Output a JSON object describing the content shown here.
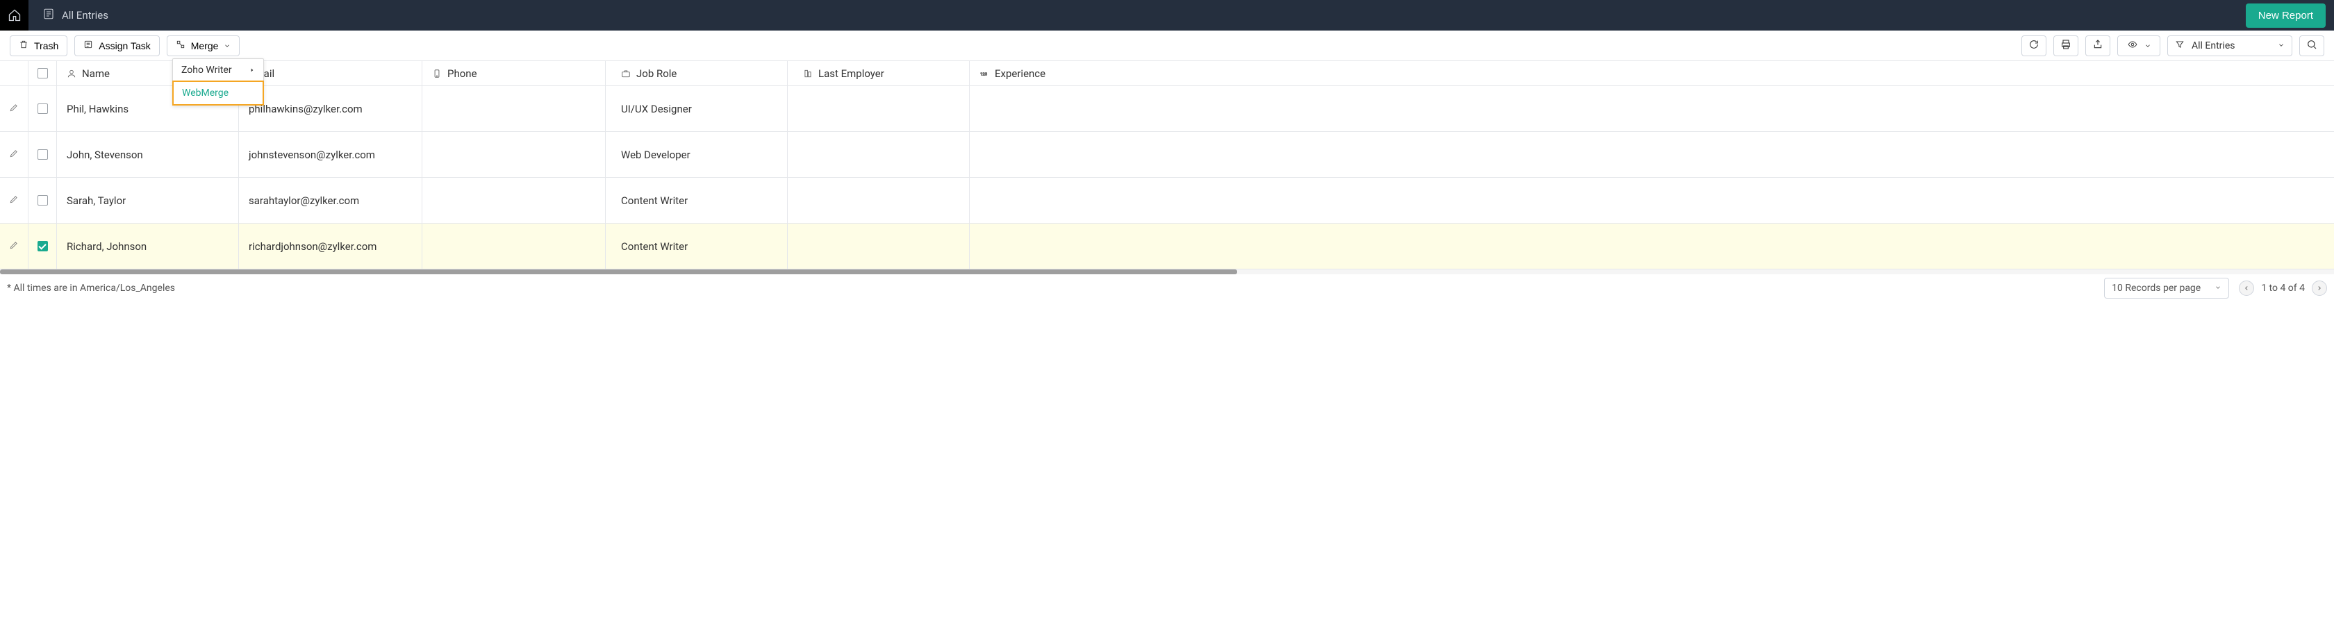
{
  "header": {
    "page_title": "All Entries",
    "new_report_label": "New Report"
  },
  "toolbar": {
    "trash_label": "Trash",
    "assign_task_label": "Assign Task",
    "merge_label": "Merge",
    "filter_label": "All Entries",
    "merge_menu": {
      "zoho_writer": "Zoho Writer",
      "webmerge": "WebMerge"
    }
  },
  "columns": {
    "name": "Name",
    "email": "Email",
    "phone": "Phone",
    "jobrole": "Job Role",
    "lastemp": "Last Employer",
    "experience": "Experience"
  },
  "rows": [
    {
      "name": "Phil, Hawkins",
      "email": "philhawkins@zylker.com",
      "phone": "",
      "jobrole": "UI/UX Designer",
      "lastemp": "",
      "experience": "",
      "checked": false
    },
    {
      "name": "John, Stevenson",
      "email": "johnstevenson@zylker.com",
      "phone": "",
      "jobrole": "Web Developer",
      "lastemp": "",
      "experience": "",
      "checked": false
    },
    {
      "name": "Sarah, Taylor",
      "email": "sarahtaylor@zylker.com",
      "phone": "",
      "jobrole": "Content Writer",
      "lastemp": "",
      "experience": "",
      "checked": false
    },
    {
      "name": "Richard, Johnson",
      "email": "richardjohnson@zylker.com",
      "phone": "",
      "jobrole": "Content Writer",
      "lastemp": "",
      "experience": "",
      "checked": true
    }
  ],
  "footer": {
    "tz_note": "* All times are in America/Los_Angeles",
    "records_per_page": "10 Records per page",
    "page_info": "1 to 4 of 4"
  }
}
